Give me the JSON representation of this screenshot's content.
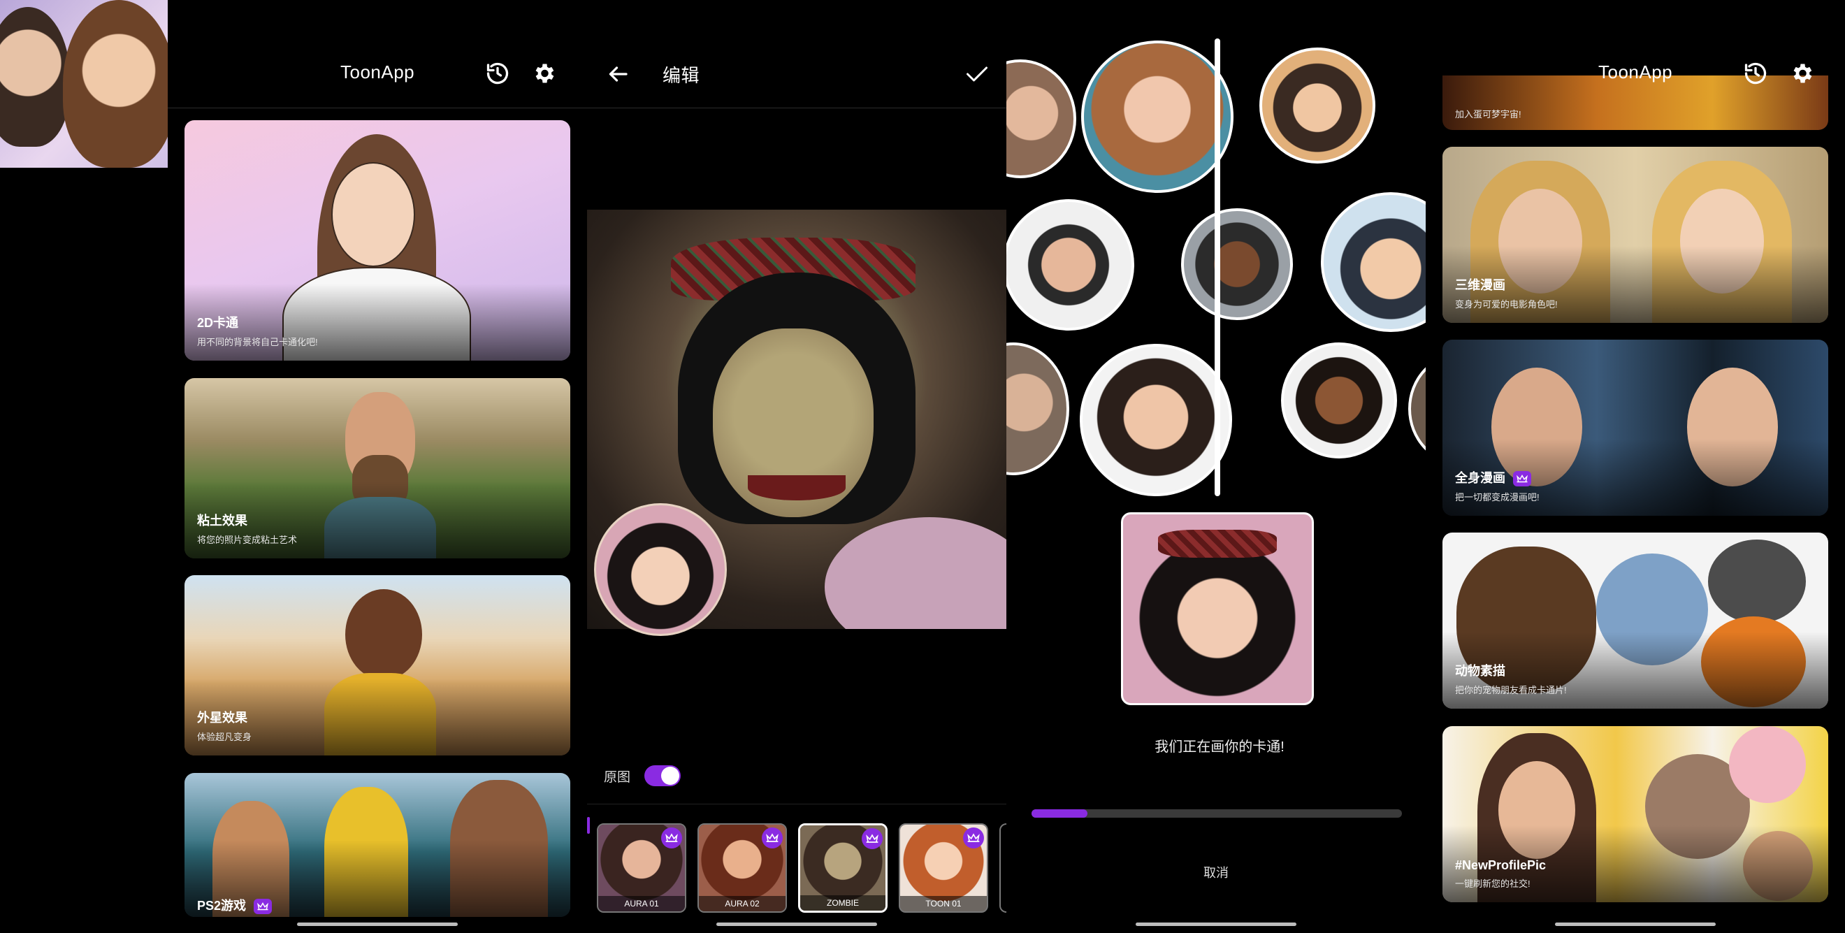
{
  "colors": {
    "accent": "#8a2be2",
    "background": "#000000"
  },
  "home": {
    "title": "ToonApp",
    "cards": [
      {
        "title": "2D卡通",
        "subtitle": "用不同的背景将自己卡通化吧!",
        "premium": false
      },
      {
        "title": "粘土效果",
        "subtitle": "将您的照片变成粘土艺术",
        "premium": false
      },
      {
        "title": "外星效果",
        "subtitle": "体验超凡变身",
        "premium": false
      },
      {
        "title": "PS2游戏",
        "subtitle": "",
        "premium": true
      }
    ]
  },
  "editor": {
    "title": "编辑",
    "toggle_label": "原图",
    "toggle_on": true,
    "styles": [
      {
        "label": "AURA 01",
        "premium": true,
        "selected": false
      },
      {
        "label": "AURA 02",
        "premium": true,
        "selected": false
      },
      {
        "label": "ZOMBIE",
        "premium": true,
        "selected": true
      },
      {
        "label": "TOON 01",
        "premium": true,
        "selected": false
      }
    ]
  },
  "processing": {
    "message": "我们正在画你的卡通!",
    "progress": 0.15,
    "cancel_label": "取消"
  },
  "home2": {
    "title": "ToonApp",
    "cards": [
      {
        "title": "",
        "subtitle": "加入蛋可梦宇宙!",
        "premium": false
      },
      {
        "title": "三维漫画",
        "subtitle": "变身为可爱的电影角色吧!",
        "premium": false
      },
      {
        "title": "全身漫画",
        "subtitle": "把一切都变成漫画吧!",
        "premium": true
      },
      {
        "title": "动物素描",
        "subtitle": "把你的宠物朋友看成卡通片!",
        "premium": false
      },
      {
        "title": "#NewProfilePic",
        "subtitle": "一键刷新您的社交!",
        "premium": false
      }
    ]
  }
}
